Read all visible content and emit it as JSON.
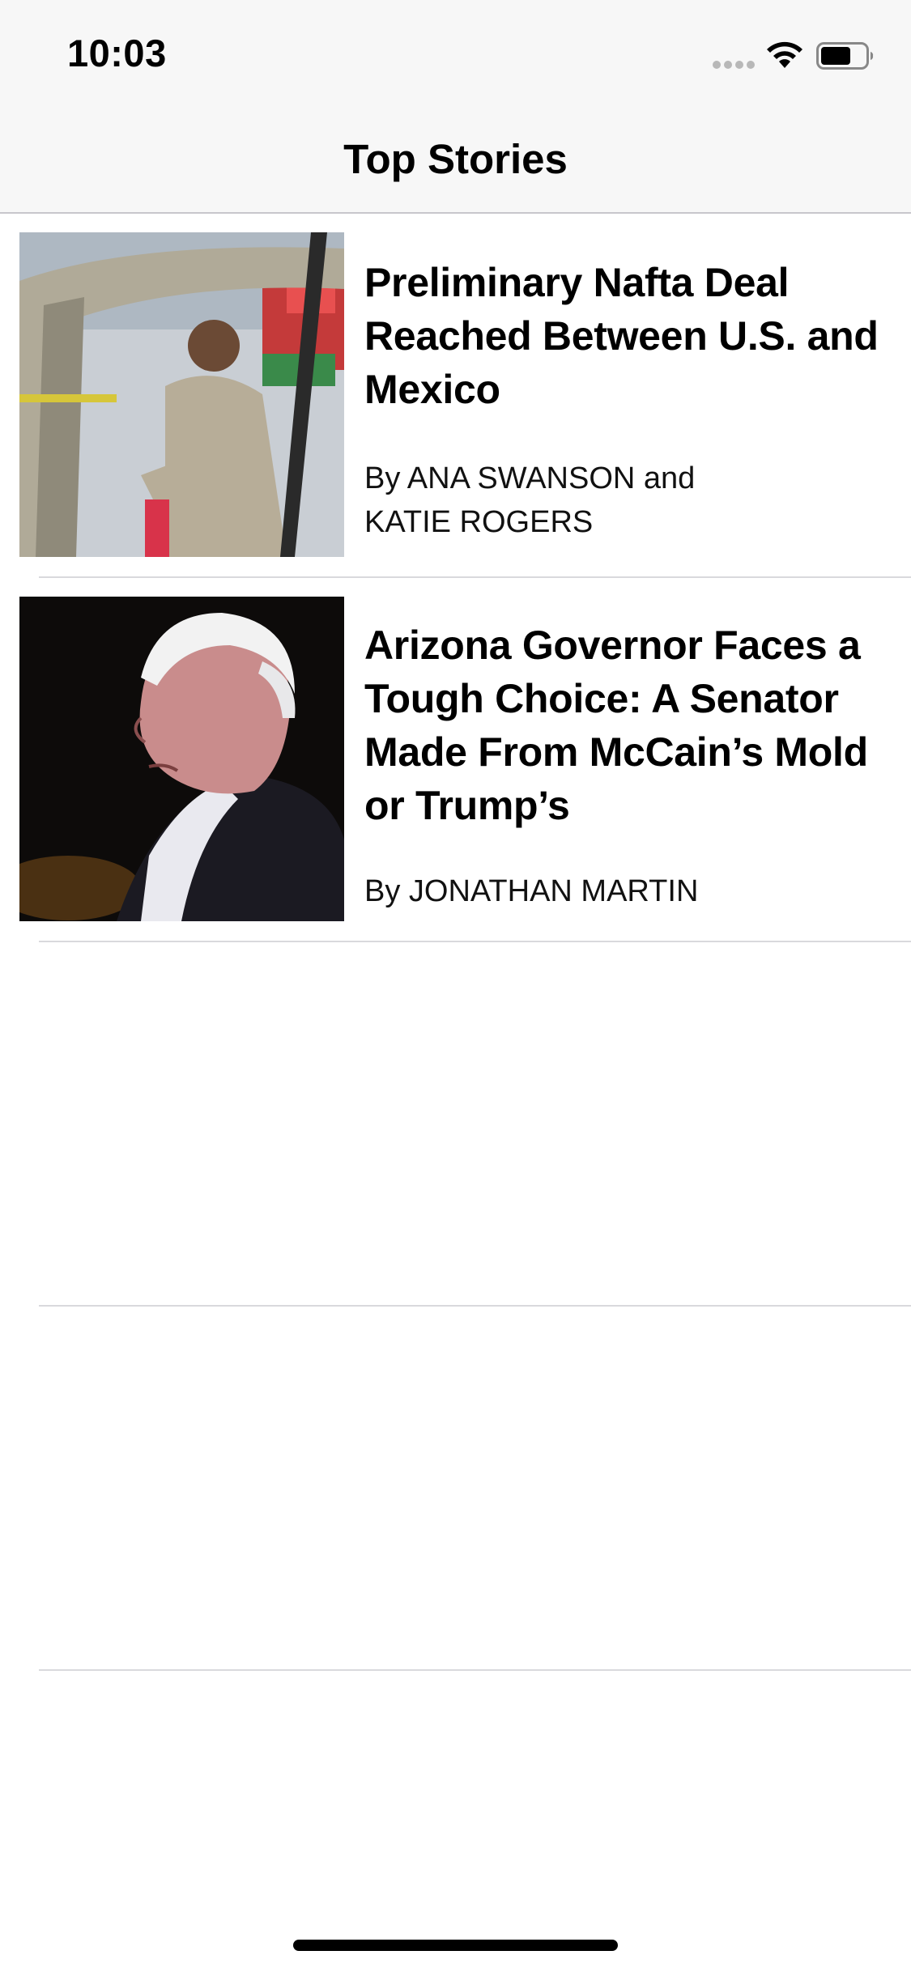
{
  "status_bar": {
    "time": "10:03",
    "icons": [
      "signal-dots-icon",
      "wifi-icon",
      "battery-icon"
    ],
    "battery_level": 0.6
  },
  "nav": {
    "title": "Top Stories"
  },
  "stories": [
    {
      "headline": "Preliminary Nafta Deal Reached Between U.S. and Mexico",
      "byline_line1": "By ANA SWANSON and",
      "byline_line2": "KATIE ROGERS"
    },
    {
      "headline": "Arizona Governor Faces a Tough Choice: A Senator Made From McCain’s Mold or Trump’s",
      "byline_line1": "By JONATHAN MARTIN"
    }
  ],
  "colors": {
    "nav_background": "#f7f7f7",
    "separator": "#d9d9dd",
    "text": "#000000"
  }
}
